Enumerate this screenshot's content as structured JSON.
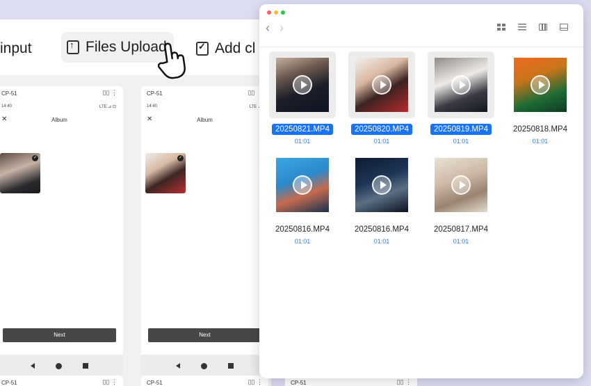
{
  "background_app": {
    "toolbar": {
      "input_label": "input",
      "upload_label": "Files Upload",
      "add_label": "Add cl"
    },
    "phones": [
      {
        "device": "CP-51",
        "time": "14:40",
        "network": "LTE ⊿ ⊡",
        "title": "Album",
        "close": "✕",
        "check": "✓",
        "next": "Next",
        "icons": "▯▯ ⋮"
      },
      {
        "device": "CP-51",
        "time": "14:40",
        "network": "LTE ⊿",
        "title": "Album",
        "close": "✕",
        "check": "✓",
        "next": "Next",
        "icons": "▯▯ ⋮"
      }
    ],
    "bottom_phones": [
      {
        "device": "CP-51",
        "icons": "▯▯ ⋮"
      },
      {
        "device": "CP-51",
        "icons": "▯▯ ⋮"
      },
      {
        "device": "CP-51",
        "icons": "▯▯ ⋮"
      }
    ]
  },
  "finder": {
    "lights": [
      "#ff5f57",
      "#febc2e",
      "#28c840"
    ],
    "nav": {
      "back": "‹",
      "forward": "›"
    },
    "view_icons": [
      "grid-view-icon",
      "list-view-icon",
      "column-view-icon",
      "gallery-view-icon"
    ],
    "files": [
      {
        "name": "20250821.MP4",
        "duration": "01:01",
        "selected": true,
        "thumb": "linear-gradient(160deg,#c6b09f 0%,#6d5a4f 30%,#1c1f2a 60%,#0d1322 100%)"
      },
      {
        "name": "20250820.MP4",
        "duration": "01:01",
        "selected": true,
        "thumb": "linear-gradient(150deg,#f1f1f1 0%,#d9b7a0 35%,#3a2321 60%,#b72a2d 100%)"
      },
      {
        "name": "20250819.MP4",
        "duration": "01:01",
        "selected": true,
        "thumb": "linear-gradient(160deg,#8f8a84 0%,#efece8 40%,#3a3b44 70%,#15171f 100%)"
      },
      {
        "name": "20250818.MP4",
        "duration": "01:01",
        "selected": false,
        "thumb": "linear-gradient(160deg,#ef6a1e 0%,#c9751b 35%,#1d6b35 70%,#0e3b20 100%)"
      },
      {
        "name": "20250816.MP4",
        "duration": "01:01",
        "selected": false,
        "thumb": "linear-gradient(160deg,#3aa7e5 0%,#2c89c9 40%,#c66b4d 65%,#16324f 100%)"
      },
      {
        "name": "20250816.MP4",
        "duration": "01:01",
        "selected": false,
        "thumb": "linear-gradient(160deg,#0f1c30 0%,#1d3556 40%,#5b6f84 65%,#0a1120 100%)"
      },
      {
        "name": "20250817.MP4",
        "duration": "01:01",
        "selected": false,
        "thumb": "linear-gradient(160deg,#e9e2d7 0%,#cdb9a5 40%,#9a8370 70%,#e2dccf 100%)"
      }
    ]
  }
}
